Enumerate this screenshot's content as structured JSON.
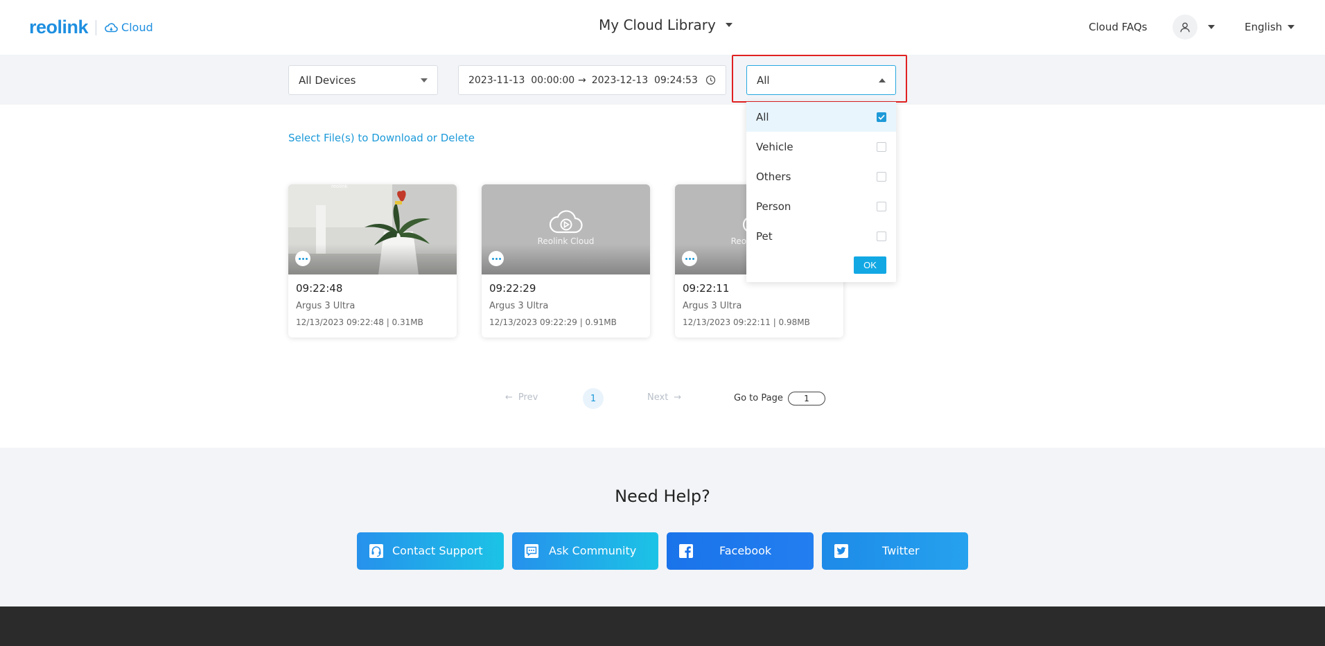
{
  "header": {
    "logo_text": "reolink",
    "logo_product": "Cloud",
    "title": "My Cloud Library",
    "faq_label": "Cloud FAQs",
    "language": "English"
  },
  "filters": {
    "device_select": "All Devices",
    "date_start": "2023-11-13  00:00:00",
    "date_end": "2023-12-13  09:24:53",
    "type_select": "All",
    "type_options": [
      {
        "label": "All",
        "checked": true
      },
      {
        "label": "Vehicle",
        "checked": false
      },
      {
        "label": "Others",
        "checked": false
      },
      {
        "label": "Person",
        "checked": false
      },
      {
        "label": "Pet",
        "checked": false
      }
    ],
    "ok_label": "OK"
  },
  "main": {
    "select_files_link": "Select File(s) to Download or Delete",
    "cards": [
      {
        "time": "09:22:48",
        "device": "Argus 3 Ultra",
        "meta": "12/13/2023 09:22:48 | 0.31MB",
        "thumbnail": "camera-snapshot"
      },
      {
        "time": "09:22:29",
        "device": "Argus 3 Ultra",
        "meta": "12/13/2023 09:22:29 | 0.91MB",
        "thumbnail": "placeholder",
        "placeholder_label": "Reolink Cloud"
      },
      {
        "time": "09:22:11",
        "device": "Argus 3 Ultra",
        "meta": "12/13/2023 09:22:11 | 0.98MB",
        "thumbnail": "placeholder",
        "placeholder_label": "Reolink Cloud"
      }
    ]
  },
  "pagination": {
    "prev_label": "Prev",
    "current_page": "1",
    "next_label": "Next",
    "goto_label": "Go to Page",
    "goto_value": "1"
  },
  "help": {
    "title": "Need Help?",
    "buttons": [
      {
        "label": "Contact Support",
        "icon": "headset-icon"
      },
      {
        "label": "Ask Community",
        "icon": "chat-icon"
      },
      {
        "label": "Facebook",
        "icon": "facebook-icon"
      },
      {
        "label": "Twitter",
        "icon": "twitter-icon"
      }
    ]
  },
  "colors": {
    "brand": "#1e8fe0",
    "accent": "#1c9ad9",
    "highlight": "#e02020",
    "footer": "#2b2b2b"
  }
}
